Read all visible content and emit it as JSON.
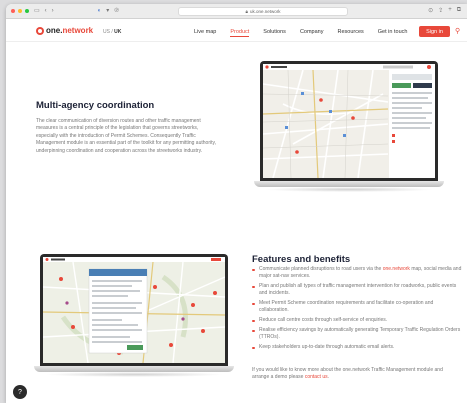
{
  "browser": {
    "url": "uk.one.network",
    "back_icon": "chevron-left-icon",
    "forward_icon": "chevron-right-icon"
  },
  "nav": {
    "logo_prefix": "one.",
    "logo_suffix": "network",
    "region_us": "US",
    "region_sep": "/",
    "region_uk": "UK",
    "links": [
      "Live map",
      "Product",
      "Solutions",
      "Company",
      "Resources",
      "Get in touch"
    ],
    "active_link": "Product",
    "signin_label": "Sign in",
    "accent": "#e8483a"
  },
  "section1": {
    "title": "Multi-agency coordination",
    "body": "The clear communication of diversion routes and other traffic management measures is a central principle of the legislation that governs streetworks, especially with the introduction of Permit Schemes. Consequently Traffic Management module is an essential part of the toolkit for any permitting authority, underpinning coordination and cooperation across the streetworks industry."
  },
  "section2": {
    "title": "Features and benefits",
    "items": [
      {
        "pre": "Communicate planned disruptions to road users via the ",
        "link": "one.network",
        "post": " map, social media and major sat-nav services."
      },
      {
        "pre": "Plan and publish all types of traffic management intervention for roadworks, public events and incidents.",
        "link": "",
        "post": ""
      },
      {
        "pre": "Meet Permit Scheme coordination requirements and facilitate co-operation and collaboration.",
        "link": "",
        "post": ""
      },
      {
        "pre": "Reduce call centre costs through self-service of enquiries.",
        "link": "",
        "post": ""
      },
      {
        "pre": "Realise efficiency savings by automatically generating Temporary Traffic Regulation Orders (TTROs).",
        "link": "",
        "post": ""
      },
      {
        "pre": "Keep stakeholders up-to-date through automatic email alerts.",
        "link": "",
        "post": ""
      }
    ],
    "contact_pre": "If you would like to know more about the one.network Traffic Management module and arrange a demo please ",
    "contact_link": "contact us",
    "contact_post": "."
  },
  "help_icon": "help-icon"
}
